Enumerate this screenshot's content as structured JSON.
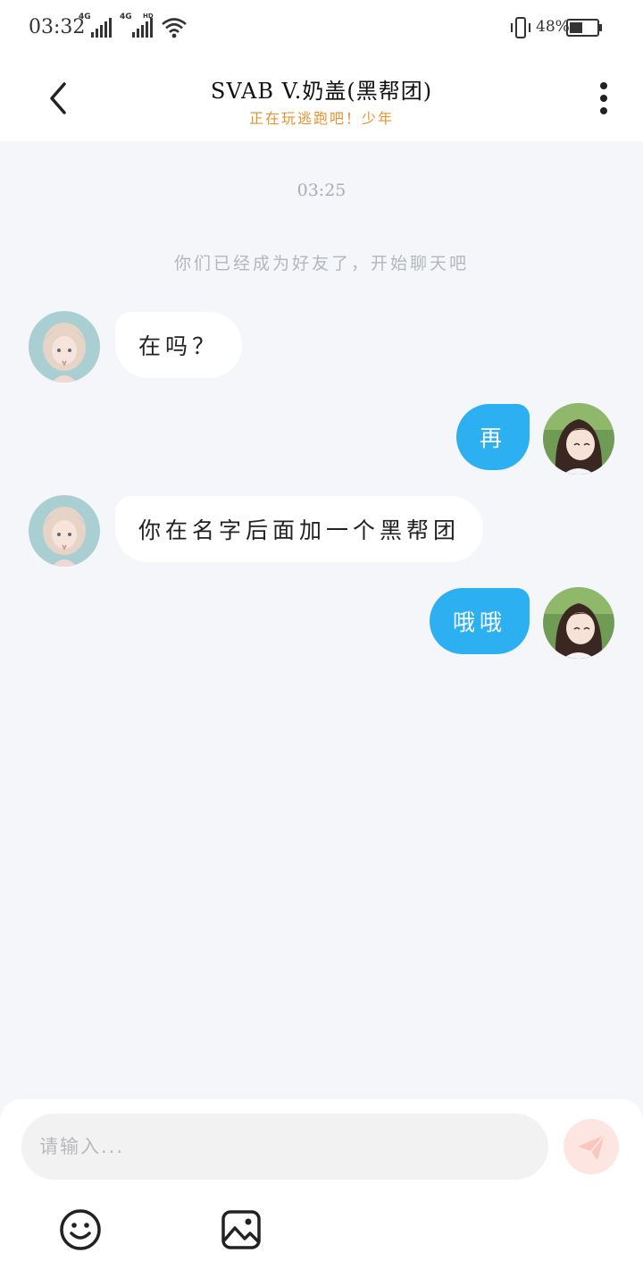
{
  "status_bar": {
    "time": "03:32",
    "signal1_label": "4G",
    "signal2_label": "4G",
    "signal2_badge": "HD",
    "battery_percent": "48%",
    "icons": [
      "signal-icon",
      "wifi-icon",
      "vibrate-icon",
      "battery-icon"
    ]
  },
  "header": {
    "title": "SVAB V.奶盖(黑帮团)",
    "subtitle": "正在玩逃跑吧！少年",
    "back_icon": "chevron-left-icon",
    "more_icon": "more-vertical-icon"
  },
  "chat": {
    "timestamp": "03:25",
    "system_note": "你们已经成为好友了，开始聊天吧",
    "messages": [
      {
        "direction": "in",
        "text": "在吗？"
      },
      {
        "direction": "out",
        "text": "再"
      },
      {
        "direction": "in",
        "text": "你在名字后面加一个黑帮团"
      },
      {
        "direction": "out",
        "text": "哦哦"
      }
    ]
  },
  "composer": {
    "placeholder": "请输入...",
    "value": "",
    "send_icon": "send-icon",
    "emoji_icon": "emoji-icon",
    "image_icon": "image-icon"
  },
  "colors": {
    "outgoing_bubble": "#2db0f2",
    "incoming_bubble": "#ffffff",
    "subtitle": "#e8922f",
    "background": "#f4f6f9",
    "send_button": "#fde6e2"
  }
}
